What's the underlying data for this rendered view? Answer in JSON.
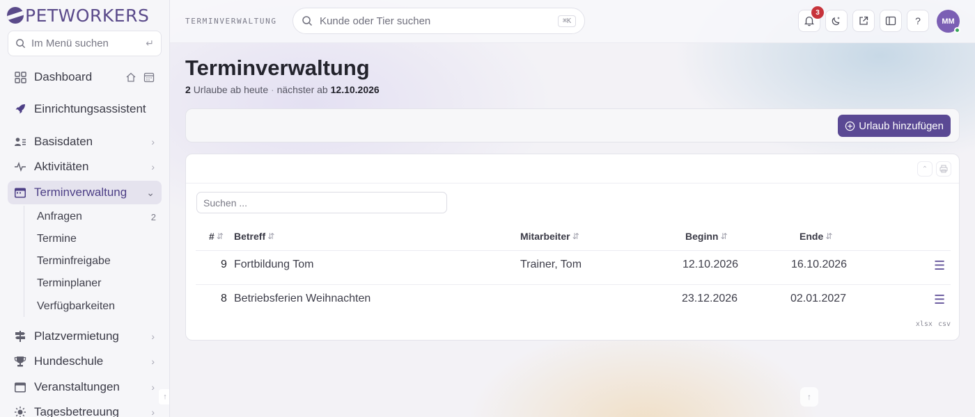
{
  "brand": {
    "name": "PETWORKERS",
    "color": "#5a4a8a"
  },
  "sidebar": {
    "search_placeholder": "Im Menü suchen",
    "search_enter_glyph": "↵",
    "items": [
      {
        "label": "Dashboard",
        "icon": "grid-icon"
      },
      {
        "label": "Einrichtungsassistent",
        "icon": "rocket-icon"
      },
      {
        "label": "Basisdaten",
        "icon": "address-card-icon"
      },
      {
        "label": "Aktivitäten",
        "icon": "pulse-icon"
      },
      {
        "label": "Terminverwaltung",
        "icon": "calendar-icon",
        "active": true
      },
      {
        "label": "Platzvermietung",
        "icon": "signpost-icon"
      },
      {
        "label": "Hundeschule",
        "icon": "trophy-icon"
      },
      {
        "label": "Veranstaltungen",
        "icon": "calendar-box-icon"
      },
      {
        "label": "Tagesbetreuung",
        "icon": "sun-icon"
      }
    ],
    "subitems": [
      {
        "label": "Anfragen",
        "count": "2"
      },
      {
        "label": "Termine",
        "count": ""
      },
      {
        "label": "Terminfreigabe",
        "count": ""
      },
      {
        "label": "Terminplaner",
        "count": ""
      },
      {
        "label": "Verfügbarkeiten",
        "count": ""
      }
    ]
  },
  "topbar": {
    "breadcrumb": "TERMINVERWALTUNG",
    "search_placeholder": "Kunde oder Tier suchen",
    "search_shortcut": "⌘K",
    "notification_count": "3",
    "help_label": "?",
    "avatar_initials": "MM"
  },
  "page": {
    "title": "Terminverwaltung",
    "subtitle_count": "2",
    "subtitle_text": "Urlaube ab heute",
    "subtitle_sep": "·",
    "subtitle_next_label": "nächster ab",
    "subtitle_next_date": "12.10.2026",
    "add_button_label": "Urlaub hinzufügen"
  },
  "table": {
    "search_placeholder": "Suchen ...",
    "columns": [
      "#",
      "Betreff",
      "Mitarbeiter",
      "Beginn",
      "Ende"
    ],
    "rows": [
      {
        "id": "9",
        "subject": "Fortbildung Tom",
        "employee": "Trainer, Tom",
        "start": "12.10.2026",
        "end": "16.10.2026"
      },
      {
        "id": "8",
        "subject": "Betriebsferien Weihnachten",
        "employee": "",
        "start": "23.12.2026",
        "end": "02.01.2027"
      }
    ],
    "export": [
      "xlsx",
      "csv"
    ]
  },
  "colors": {
    "accent": "#5a4994",
    "badge": "#c7333b",
    "avatar": "#7b5fb4"
  }
}
